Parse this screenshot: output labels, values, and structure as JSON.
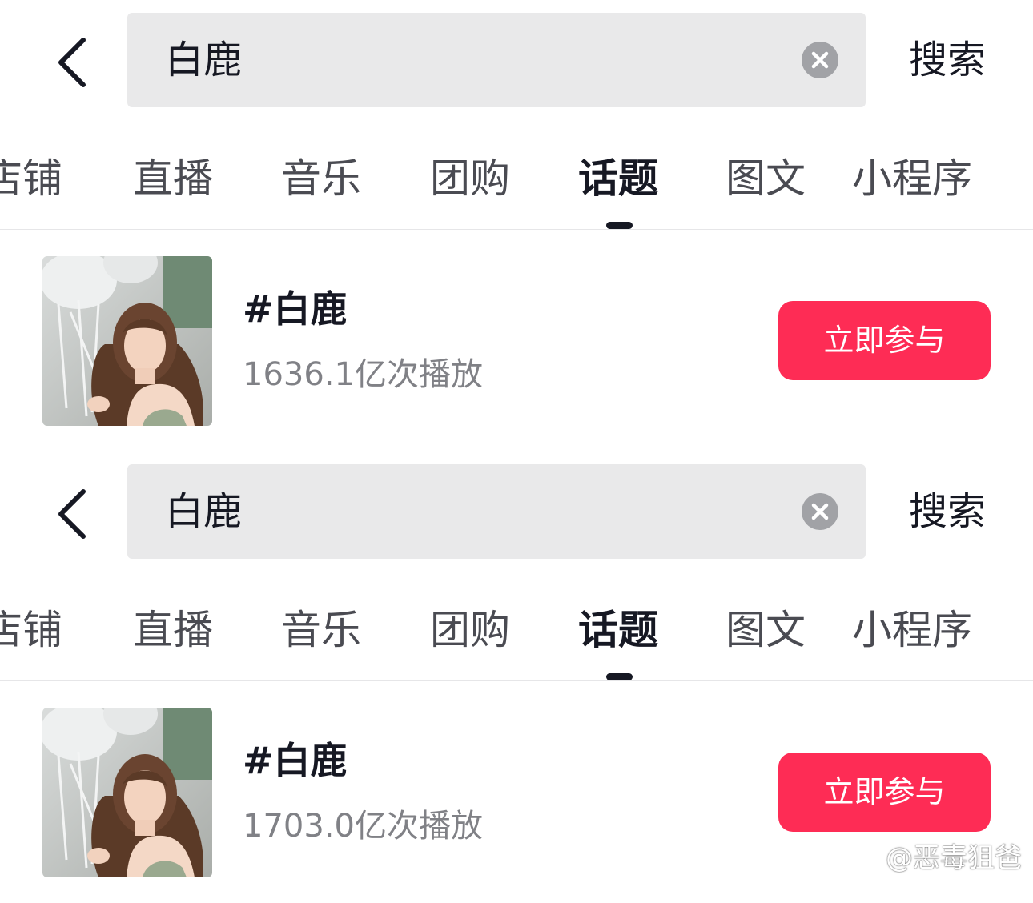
{
  "screens": [
    {
      "search": {
        "query": "白鹿",
        "submit_label": "搜索"
      },
      "tabs": [
        {
          "label": "店铺"
        },
        {
          "label": "直播"
        },
        {
          "label": "音乐"
        },
        {
          "label": "团购"
        },
        {
          "label": "话题",
          "active": true
        },
        {
          "label": "图文"
        },
        {
          "label": "小程序"
        }
      ],
      "result": {
        "title": "#白鹿",
        "plays": "1636.1亿次播放",
        "join_label": "立即参与"
      }
    },
    {
      "search": {
        "query": "白鹿",
        "submit_label": "搜索"
      },
      "tabs": [
        {
          "label": "店铺"
        },
        {
          "label": "直播"
        },
        {
          "label": "音乐"
        },
        {
          "label": "团购"
        },
        {
          "label": "话题",
          "active": true
        },
        {
          "label": "图文"
        },
        {
          "label": "小程序"
        }
      ],
      "result": {
        "title": "#白鹿",
        "plays": "1703.0亿次播放",
        "join_label": "立即参与"
      }
    }
  ],
  "watermark": {
    "text": "@恶毒狙爸"
  },
  "colors": {
    "accent": "#fe2c55",
    "search_bg": "#e9e9ea",
    "text_primary": "#161823",
    "text_secondary": "#808186"
  }
}
